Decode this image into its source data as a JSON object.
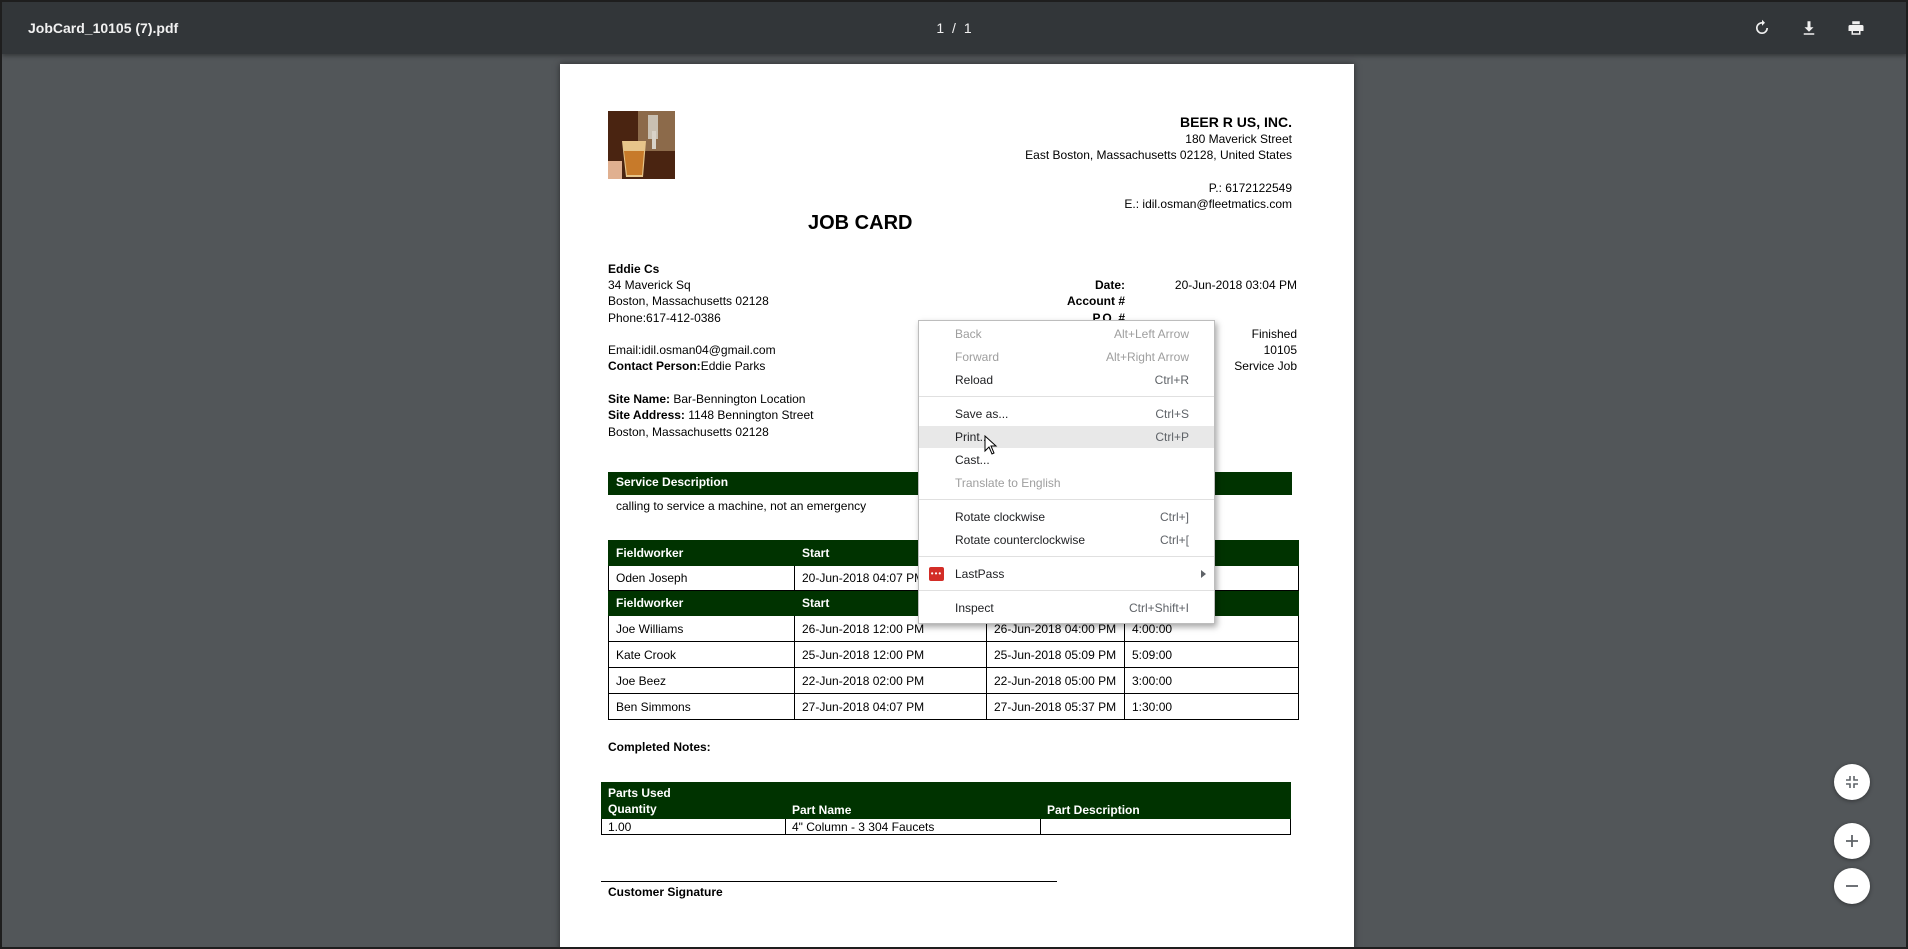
{
  "toolbar": {
    "file_name": "JobCard_10105 (7).pdf",
    "page_current": "1",
    "page_sep": "/",
    "page_total": "1",
    "rotate_icon": "rotate-icon",
    "download_icon": "download-icon",
    "print_icon": "print-icon"
  },
  "company": {
    "name": "BEER R US, INC.",
    "street": "180 Maverick Street",
    "city": "East Boston, Massachusetts 02128, United States",
    "phone": "P.: 6172122549",
    "email": "E.: idil.osman@fleetmatics.com"
  },
  "doc_title": "JOB CARD",
  "customer": {
    "name": "Eddie Cs",
    "street": "34 Maverick Sq",
    "city": "Boston, Massachusetts 02128",
    "phone": "Phone:617-412-0386",
    "email": "Email:idil.osman04@gmail.com",
    "contact_label": "Contact Person:",
    "contact_value": "Eddie Parks",
    "site_name_label": "Site Name:",
    "site_name_value": " Bar-Bennington Location",
    "site_address_label": "Site Address:",
    "site_address_value": " 1148 Bennington Street",
    "site_city": "Boston, Massachusetts 02128"
  },
  "meta": {
    "date_label": "Date:",
    "date_value": "20-Jun-2018 03:04 PM",
    "account_label": "Account #",
    "po_label": "P.O. #",
    "status_value": "Finished",
    "number_value": "10105",
    "type_value": "Service Job"
  },
  "service": {
    "header": "Service Description",
    "text": "calling to service a machine,  not an emergency"
  },
  "fieldwork_table": {
    "headers": [
      "Fieldworker",
      "Start",
      "",
      ""
    ],
    "rows": [
      [
        "Oden Joseph",
        "20-Jun-2018 04:07 PM",
        "",
        ""
      ]
    ]
  },
  "labor_table": {
    "headers": [
      "Fieldworker",
      "Start",
      "",
      ""
    ],
    "rows": [
      [
        " Joe  Williams",
        "26-Jun-2018 12:00 PM",
        "26-Jun-2018 04:00 PM",
        "4:00:00"
      ],
      [
        " Kate Crook",
        "25-Jun-2018 12:00 PM",
        "25-Jun-2018 05:09 PM",
        "5:09:00"
      ],
      [
        " Joe Beez",
        "22-Jun-2018 02:00 PM",
        "22-Jun-2018 05:00 PM",
        "3:00:00"
      ],
      [
        " Ben Simmons",
        "27-Jun-2018 04:07 PM",
        "27-Jun-2018 05:37 PM",
        "1:30:00"
      ]
    ]
  },
  "completed_notes_label": "Completed Notes:",
  "parts": {
    "title": "Parts Used",
    "headers": [
      "Quantity",
      "Part Name",
      "Part Description"
    ],
    "rows": [
      [
        "1.00",
        "4\" Column - 3 304 Faucets",
        ""
      ]
    ]
  },
  "signature_label": "Customer Signature",
  "context_menu": {
    "items": [
      {
        "label": "Back",
        "shortcut": "Alt+Left Arrow"
      },
      {
        "label": "Forward",
        "shortcut": "Alt+Right Arrow"
      },
      {
        "label": "Reload",
        "shortcut": "Ctrl+R"
      },
      {
        "label": "Save as...",
        "shortcut": "Ctrl+S"
      },
      {
        "label": "Print...",
        "shortcut": "Ctrl+P"
      },
      {
        "label": "Cast...",
        "shortcut": ""
      },
      {
        "label": "Translate to English",
        "shortcut": ""
      },
      {
        "label": "Rotate clockwise",
        "shortcut": "Ctrl+]"
      },
      {
        "label": "Rotate counterclockwise",
        "shortcut": "Ctrl+["
      },
      {
        "label": "LastPass",
        "shortcut": ""
      },
      {
        "label": "Inspect",
        "shortcut": "Ctrl+Shift+I"
      }
    ]
  },
  "zoom_controls": {
    "fit_icon": "fit-page-icon",
    "zoom_in_icon": "zoom-in-icon",
    "zoom_out_icon": "zoom-out-icon"
  },
  "colors": {
    "toolbar_bg": "#323639",
    "viewer_bg": "#525659",
    "table_header_green": "#003300",
    "lastpass_red": "#d32d27"
  }
}
